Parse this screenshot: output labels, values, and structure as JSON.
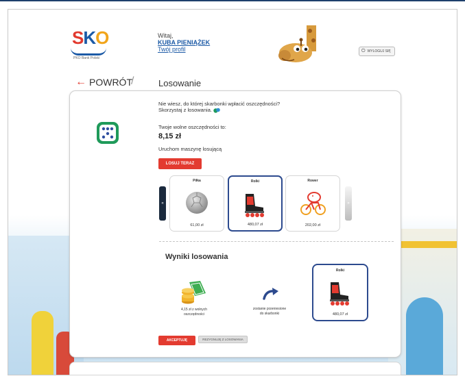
{
  "header": {
    "logo": {
      "letters": [
        "S",
        "K",
        "O"
      ],
      "subtitle": "PKO Bank Polski"
    },
    "greeting": "Witaj,",
    "user_name": "KUBA PIENIĄŻEK",
    "profile_link": "Twój profil",
    "logout_label": "WYLOGUJ SIĘ"
  },
  "nav": {
    "back_label": "POWRÓT",
    "separator": "/",
    "page_title": "Losowanie"
  },
  "draw": {
    "question": "Nie wiesz, do której skarbonki wpłacić oszczędności?",
    "hint": "Skorzystaj z losowania.",
    "savings_label": "Twoje wolne oszczędności to:",
    "savings_amount": "8,15 zł",
    "machine_label": "Uruchom maszynę losującą",
    "draw_button": "LOSUJ TERAZ",
    "prev_arrow": "«",
    "next_arrow": "»"
  },
  "products": [
    {
      "name": "Piłka",
      "price": "61,00 zł",
      "icon": "ball-icon",
      "selected": false
    },
    {
      "name": "Rolki",
      "price": "480,07 zł",
      "icon": "rollerskates-icon",
      "selected": true
    },
    {
      "name": "Rower",
      "price": "202,00 zł",
      "icon": "bike-piggy-icon",
      "selected": false
    }
  ],
  "results": {
    "title": "Wyniki losowania",
    "coins_text_1": "4,15 zł z wolnych",
    "coins_text_2": "oszczędności",
    "transfer_text_1": "zostanie przeniesione",
    "transfer_text_2": "do skarbonki",
    "product_name": "Rolki",
    "product_price": "480,07 zł"
  },
  "actions": {
    "accept_label": "AKCEPTUJĘ",
    "resign_label": "REZYGNUJĘ Z LOSOWANIA"
  },
  "colors": {
    "brand_red": "#e33b30",
    "brand_blue": "#1c5aa6",
    "selected_border": "#2c4a8e",
    "dice_green": "#1f9a5a"
  }
}
